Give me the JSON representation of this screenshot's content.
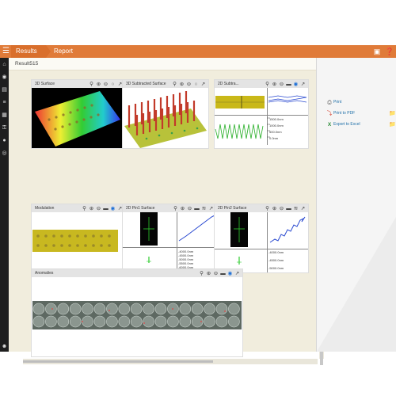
{
  "topbar": {
    "menu_icon": "hamburger-icon",
    "tabs": [
      {
        "label": "Results",
        "active": true
      },
      {
        "label": "Report",
        "active": false
      }
    ],
    "right_icons": [
      "report-icon",
      "help-icon"
    ]
  },
  "rail": {
    "icons": [
      "home-icon",
      "globe-icon",
      "book-icon",
      "sliders-icon",
      "layers-icon",
      "key-icon",
      "users-icon",
      "target-icon"
    ],
    "bottom_icon": "user-icon"
  },
  "breadcrumb": "Result515",
  "panels": [
    {
      "title": "3D Surface",
      "tools": [
        "search-icon",
        "zoom-in-icon",
        "zoom-out-icon",
        "circle-icon",
        "expand-icon"
      ]
    },
    {
      "title": "3D Subtracted Surface",
      "tools": [
        "search-icon",
        "zoom-in-icon",
        "zoom-out-icon",
        "circle-icon",
        "expand-icon"
      ]
    },
    {
      "title": "2D Subtra...",
      "tools": [
        "search-icon",
        "zoom-in-icon",
        "zoom-out-icon",
        "ruler-icon",
        "target-icon",
        "expand-icon"
      ],
      "readouts": [
        "1500.0nm",
        "1000.0nm",
        "500.0nm",
        "0.0nm"
      ]
    },
    {
      "title": "Modulation",
      "tools": [
        "search-icon",
        "zoom-in-icon",
        "zoom-out-icon",
        "ruler-icon",
        "target-icon",
        "expand-icon"
      ]
    },
    {
      "title": "2D Pin1 Surface",
      "tools": [
        "search-icon",
        "zoom-in-icon",
        "zoom-out-icon",
        "ruler-icon",
        "chart-icon",
        "expand-icon"
      ],
      "readouts": [
        "-4000.0nm",
        "-4500.0nm",
        "-5000.0nm",
        "-5500.0nm",
        "-6000.0nm"
      ]
    },
    {
      "title": "2D Pin2 Surface",
      "tools": [
        "search-icon",
        "zoom-in-icon",
        "zoom-out-icon",
        "ruler-icon",
        "chart-icon",
        "expand-icon"
      ],
      "readouts": [
        "-4000.0nm",
        "-4500.0nm",
        "-5000.0nm"
      ]
    },
    {
      "title": "Anomalies",
      "tools": [
        "search-icon",
        "zoom-in-icon",
        "zoom-out-icon",
        "ruler-icon",
        "target-icon",
        "expand-icon"
      ]
    }
  ],
  "sidebar": {
    "items": [
      {
        "label": "Print",
        "icon": "printer-icon"
      },
      {
        "label": "Print to PDF",
        "icon": "pdf-icon"
      },
      {
        "label": "Export to Excel",
        "icon": "excel-icon"
      }
    ]
  },
  "colors": {
    "accent": "#e07b39",
    "background": "#f1eddd",
    "link": "#1e6fa8"
  }
}
